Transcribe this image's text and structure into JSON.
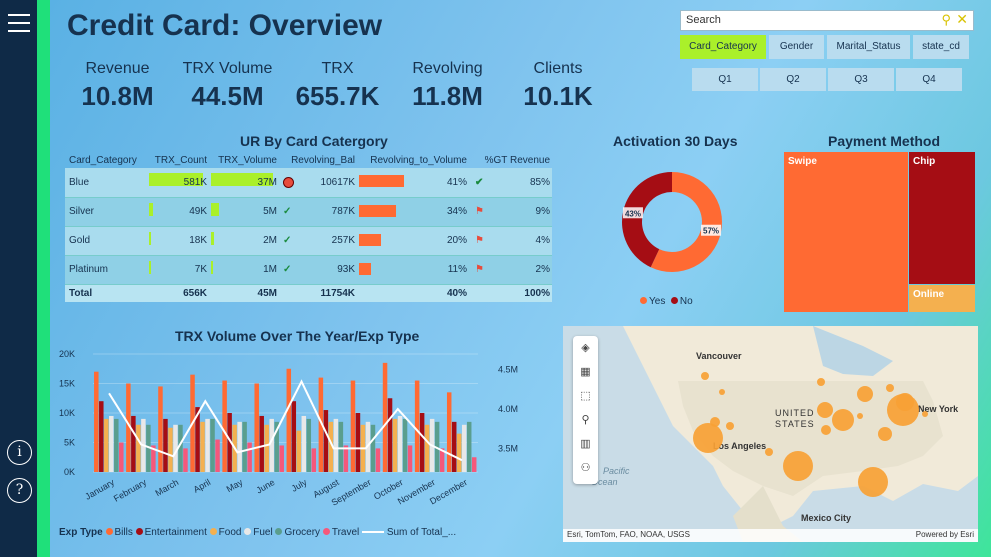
{
  "nav": {
    "menu_icon": "hamburger-icon",
    "info_icon": "info-icon",
    "help_icon": "help-icon",
    "info_glyph": "i",
    "help_glyph": "?"
  },
  "header": {
    "title": "Credit Card: Overview"
  },
  "kpis": [
    {
      "label": "Revenue",
      "value": "10.8M"
    },
    {
      "label": "TRX Volume",
      "value": "44.5M"
    },
    {
      "label": "TRX",
      "value": "655.7K"
    },
    {
      "label": "Revolving",
      "value": "11.8M"
    },
    {
      "label": "Clients",
      "value": "10.1K"
    }
  ],
  "search": {
    "placeholder": "Search"
  },
  "slicers": [
    "Card_Category",
    "Gender",
    "Marital_Status",
    "state_cd"
  ],
  "quarters": [
    "Q1",
    "Q2",
    "Q3",
    "Q4"
  ],
  "table": {
    "title": "UR By Card Catergory",
    "columns": [
      "Card_Category",
      "TRX_Count",
      "TRX_Volume",
      "Revolving_Bal",
      "Revolving_to_Volume",
      "%GT Revenue"
    ],
    "rows": [
      {
        "cat": "Blue",
        "count": "581K",
        "volume": "37M",
        "rev": "10617K",
        "rtv": "41%",
        "gt": "85%",
        "count_frac": 1.0,
        "vol_frac": 1.0,
        "rtv_frac": 0.41
      },
      {
        "cat": "Silver",
        "count": "49K",
        "volume": "5M",
        "rev": "787K",
        "rtv": "34%",
        "gt": "9%",
        "count_frac": 0.08,
        "vol_frac": 0.135,
        "rtv_frac": 0.34
      },
      {
        "cat": "Gold",
        "count": "18K",
        "volume": "2M",
        "rev": "257K",
        "rtv": "20%",
        "gt": "4%",
        "count_frac": 0.03,
        "vol_frac": 0.054,
        "rtv_frac": 0.2
      },
      {
        "cat": "Platinum",
        "count": "7K",
        "volume": "1M",
        "rev": "93K",
        "rtv": "11%",
        "gt": "2%",
        "count_frac": 0.012,
        "vol_frac": 0.027,
        "rtv_frac": 0.11
      }
    ],
    "total": {
      "label": "Total",
      "count": "656K",
      "volume": "45M",
      "rev": "11754K",
      "rtv": "40%",
      "gt": "100%"
    }
  },
  "activation": {
    "title": "Activation 30 Days",
    "yes_label": "Yes",
    "no_label": "No",
    "yes_pct": 57,
    "no_pct": 43,
    "yes_text": "57%",
    "no_text": "43%",
    "yes_color": "#ff6a33",
    "no_color": "#a50d14"
  },
  "payment": {
    "title": "Payment Method",
    "items": [
      {
        "label": "Swipe",
        "color": "#ff6a33"
      },
      {
        "label": "Chip",
        "color": "#a50d14"
      },
      {
        "label": "Online",
        "color": "#f4b04f"
      }
    ]
  },
  "map": {
    "labels": [
      "Vancouver",
      "UNITED",
      "STATES",
      "Los Angeles",
      "New York",
      "Mexico City",
      "Pacific",
      "Ocean"
    ],
    "attribution": "Esri, TomTom, FAO, NOAA, USGS",
    "powered": "Powered by Esri"
  },
  "chart_data": {
    "type": "bar",
    "title": "TRX Volume Over The Year/Exp Type",
    "categories": [
      "January",
      "February",
      "March",
      "April",
      "May",
      "June",
      "July",
      "August",
      "September",
      "October",
      "November",
      "December"
    ],
    "ylim": [
      0,
      20000
    ],
    "yticks": [
      "20K",
      "15K",
      "10K",
      "5K",
      "0K"
    ],
    "y2ticks": [
      "4.5M",
      "4.0M",
      "3.5M"
    ],
    "y2lim": [
      3.2,
      4.7
    ],
    "legend_title": "Exp Type",
    "series": [
      {
        "name": "Bills",
        "color": "#ff6a33",
        "values": [
          17000,
          15000,
          14500,
          16500,
          15500,
          15000,
          17500,
          16000,
          15500,
          18500,
          15500,
          13500
        ]
      },
      {
        "name": "Entertainment",
        "color": "#a50d14",
        "values": [
          12000,
          9500,
          9000,
          11000,
          10000,
          9500,
          12000,
          10500,
          10000,
          12500,
          10000,
          8500
        ]
      },
      {
        "name": "Food",
        "color": "#f4b04f",
        "values": [
          9000,
          8000,
          7500,
          8500,
          8000,
          8000,
          7000,
          8500,
          8000,
          9000,
          8000,
          6500
        ]
      },
      {
        "name": "Fuel",
        "color": "#e8e8e8",
        "values": [
          9500,
          9000,
          8000,
          9000,
          8500,
          9000,
          9500,
          9000,
          8500,
          9500,
          9000,
          8000
        ]
      },
      {
        "name": "Grocery",
        "color": "#5a9e8e",
        "values": [
          9000,
          8000,
          8000,
          9000,
          8500,
          8500,
          9000,
          8500,
          8000,
          9000,
          8500,
          8500
        ]
      },
      {
        "name": "Travel",
        "color": "#f5587b",
        "values": [
          5000,
          4500,
          4000,
          5500,
          5000,
          4500,
          4000,
          4500,
          4000,
          4500,
          4000,
          2500
        ]
      }
    ],
    "line": {
      "name": "Sum of Total_...",
      "values": [
        4.2,
        3.55,
        3.4,
        4.1,
        3.45,
        3.55,
        4.35,
        3.5,
        3.5,
        4.0,
        3.55,
        3.35
      ]
    }
  }
}
